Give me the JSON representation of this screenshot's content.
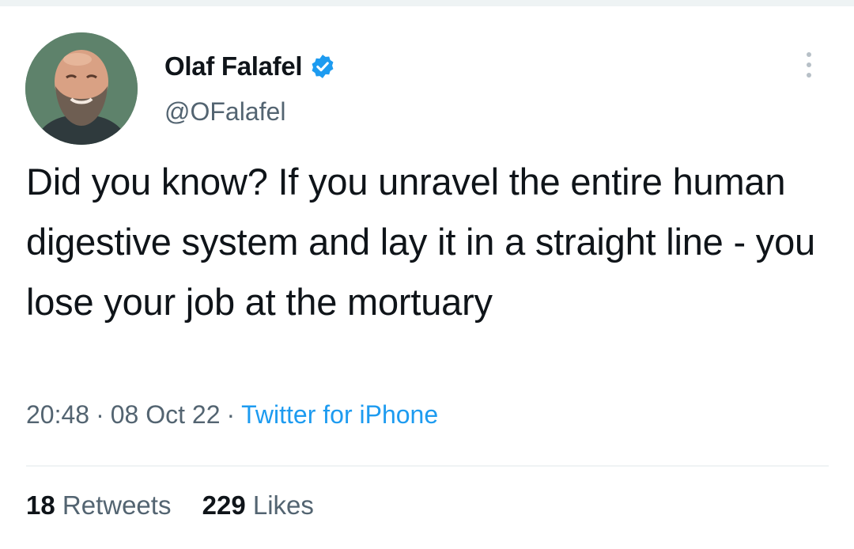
{
  "author": {
    "display_name": "Olaf Falafel",
    "handle": "@OFalafel",
    "verified": true
  },
  "tweet": {
    "text": "Did you know? If you unravel the entire human digestive system and lay it in a straight line - you lose your job at the mortuary",
    "time": "20:48",
    "date": "08 Oct 22",
    "source": "Twitter for iPhone",
    "separator": "·"
  },
  "stats": {
    "retweets_count": "18",
    "retweets_label": "Retweets",
    "likes_count": "229",
    "likes_label": "Likes"
  },
  "icons": {
    "verified": "verified-badge-icon",
    "more": "more-options-icon"
  },
  "colors": {
    "accent": "#1d9bf0",
    "text": "#0f1419",
    "secondary": "#536471"
  }
}
